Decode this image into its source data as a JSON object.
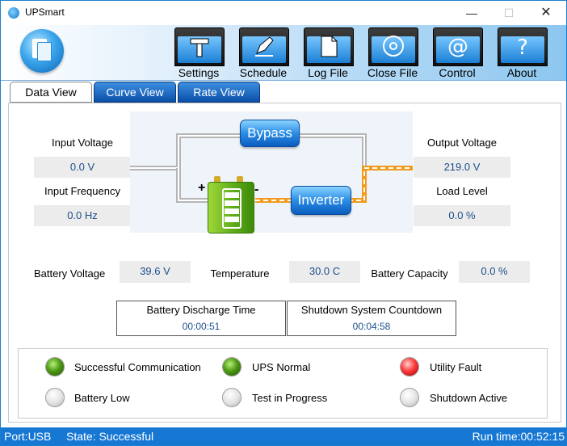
{
  "window": {
    "title": "UPSmart"
  },
  "toolbar": [
    {
      "label": "Settings"
    },
    {
      "label": "Schedule"
    },
    {
      "label": "Log File"
    },
    {
      "label": "Close File"
    },
    {
      "label": "Control"
    },
    {
      "label": "About"
    }
  ],
  "tabs": [
    {
      "label": "Data View"
    },
    {
      "label": "Curve View"
    },
    {
      "label": "Rate View"
    }
  ],
  "input": {
    "voltage_label": "Input Voltage",
    "voltage_value": "0.0 V",
    "frequency_label": "Input Frequency",
    "frequency_value": "0.0 Hz"
  },
  "output": {
    "voltage_label": "Output Voltage",
    "voltage_value": "219.0 V",
    "load_label": "Load Level",
    "load_value": "0.0 %"
  },
  "diagram": {
    "bypass_label": "Bypass",
    "inverter_label": "Inverter",
    "plus": "+",
    "minus": "-"
  },
  "battery": {
    "voltage_label": "Battery Voltage",
    "voltage_value": "39.6 V",
    "temperature_label": "Temperature",
    "temperature_value": "30.0 C",
    "capacity_label": "Battery Capacity",
    "capacity_value": "0.0 %"
  },
  "timers": {
    "discharge_label": "Battery Discharge Time",
    "discharge_value": "00:00:51",
    "shutdown_label": "Shutdown System Countdown",
    "shutdown_value": "00:04:58"
  },
  "indicators": [
    {
      "label": "Successful Communication",
      "state": "green"
    },
    {
      "label": "UPS Normal",
      "state": "green"
    },
    {
      "label": "Utility Fault",
      "state": "red"
    },
    {
      "label": "Battery Low",
      "state": "off"
    },
    {
      "label": "Test in Progress",
      "state": "off"
    },
    {
      "label": "Shutdown Active",
      "state": "off"
    }
  ],
  "statusbar": {
    "port": "Port:USB",
    "state": "State: Successful",
    "runtime": "Run time:00:52:15"
  },
  "colors": {
    "accent": "#1778d4",
    "value_text": "#1c4f8c",
    "active_line": "#f29a1b",
    "inactive_line": "#c8c8c8"
  }
}
